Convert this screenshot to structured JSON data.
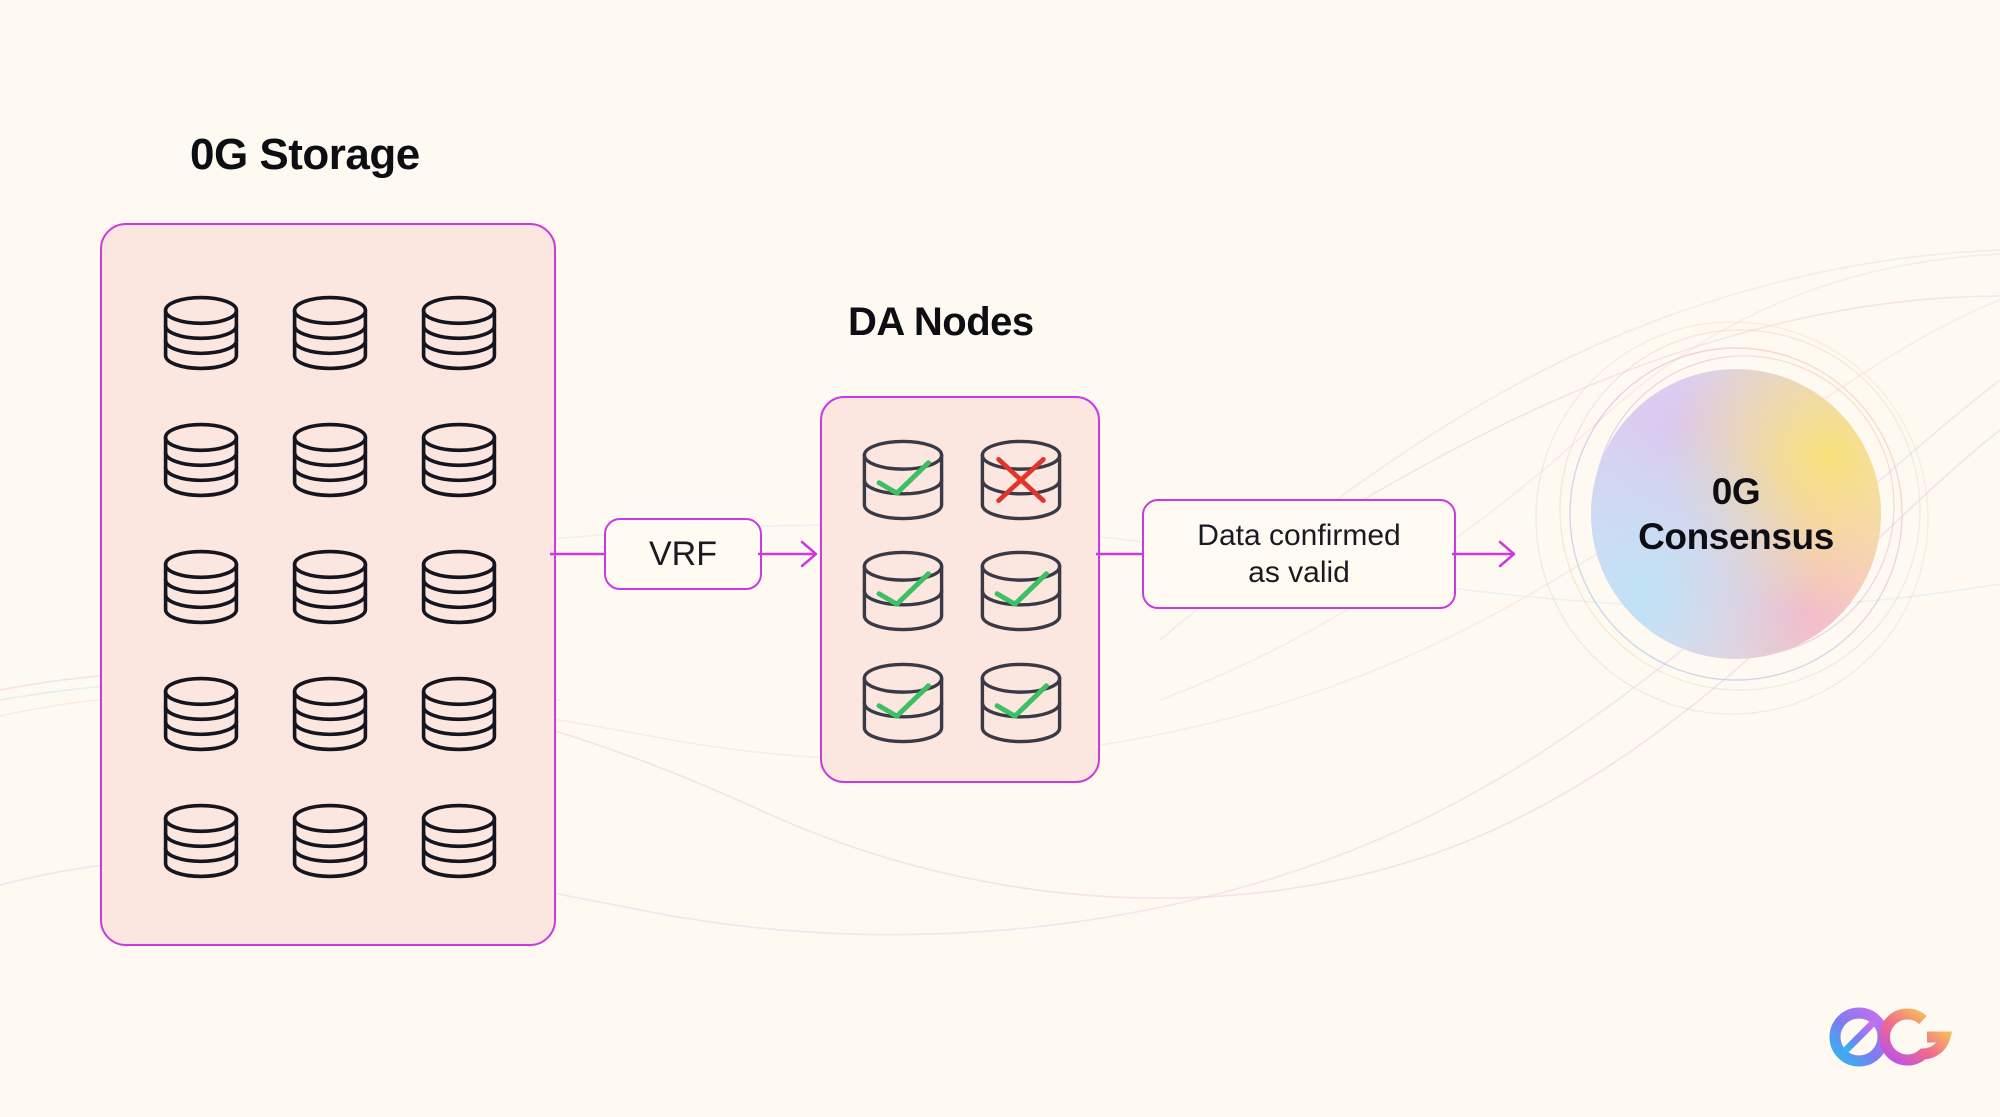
{
  "page": {
    "background_color": "#FEFAF1",
    "accent_color": "#CB3AE0",
    "panel_fill_color": "#FBE6E0",
    "check_color": "#3DBF63",
    "cross_color": "#E0342C",
    "cylinder_stroke_color": "#15151F",
    "da_cylinder_stroke_color": "#3A3A46"
  },
  "storage": {
    "title": "0G Storage",
    "columns": 3,
    "rows": 5,
    "node_count": 15,
    "nodes": [
      {
        "id": "s1",
        "status": "none"
      },
      {
        "id": "s2",
        "status": "none"
      },
      {
        "id": "s3",
        "status": "none"
      },
      {
        "id": "s4",
        "status": "none"
      },
      {
        "id": "s5",
        "status": "none"
      },
      {
        "id": "s6",
        "status": "none"
      },
      {
        "id": "s7",
        "status": "none"
      },
      {
        "id": "s8",
        "status": "none"
      },
      {
        "id": "s9",
        "status": "none"
      },
      {
        "id": "s10",
        "status": "none"
      },
      {
        "id": "s11",
        "status": "none"
      },
      {
        "id": "s12",
        "status": "none"
      },
      {
        "id": "s13",
        "status": "none"
      },
      {
        "id": "s14",
        "status": "none"
      },
      {
        "id": "s15",
        "status": "none"
      }
    ]
  },
  "vrf": {
    "label": "VRF"
  },
  "da": {
    "title": "DA Nodes",
    "columns": 2,
    "rows": 3,
    "node_count": 6,
    "nodes": [
      {
        "id": "d1",
        "status": "check"
      },
      {
        "id": "d2",
        "status": "cross"
      },
      {
        "id": "d3",
        "status": "check"
      },
      {
        "id": "d4",
        "status": "check"
      },
      {
        "id": "d5",
        "status": "check"
      },
      {
        "id": "d6",
        "status": "check"
      }
    ]
  },
  "data_valid": {
    "line1": "Data confirmed",
    "line2": "as valid"
  },
  "consensus": {
    "line1": "0G",
    "line2": "Consensus"
  },
  "brand": {
    "name": "0G",
    "zero_glyph": "Ø",
    "g_glyph": "G"
  },
  "flow": {
    "steps": [
      {
        "from": "0G Storage",
        "to": "VRF"
      },
      {
        "from": "VRF",
        "to": "DA Nodes"
      },
      {
        "from": "DA Nodes",
        "to": "Data confirmed as valid"
      },
      {
        "from": "Data confirmed as valid",
        "to": "0G Consensus"
      }
    ]
  }
}
